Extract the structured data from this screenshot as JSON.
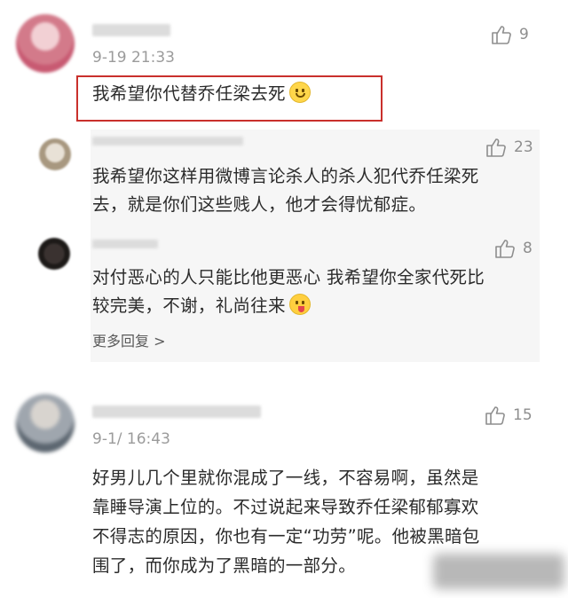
{
  "comments": [
    {
      "time": "9-19 21:33",
      "likes": "9",
      "text": "我希望你代替乔任梁去死"
    },
    {
      "time": "9-1/ 16:43",
      "likes": "15",
      "text_lines": [
        "好男儿几个里就你混成了一线，不容易啊，虽然是",
        "靠睡导演上位的。不过说起来导致乔任梁郁郁寡欢",
        "不得志的原因，你也有一定“功劳”呢。他被黑暗包",
        "围了，而你成为了黑暗的一部分。"
      ]
    }
  ],
  "replies": [
    {
      "likes": "23",
      "text_lines": [
        "我希望你这样用微博言论杀人的杀人犯代乔任梁死",
        "去，就是你们这些贱人，他才会得忧郁症。"
      ]
    },
    {
      "likes": "8",
      "text_lines": [
        "对付恶心的人只能比他更恶心 我希望你全家代死比",
        "较完美，不谢，礼尚往来"
      ]
    }
  ],
  "more_replies": "更多回复 >",
  "colors": {
    "highlight_border": "#c9302c",
    "reply_bg": "#f6f6f6"
  },
  "icons": [
    "thumbs-up-icon",
    "smile-emoji-icon",
    "tongue-emoji-icon",
    "chevron-right-icon"
  ]
}
